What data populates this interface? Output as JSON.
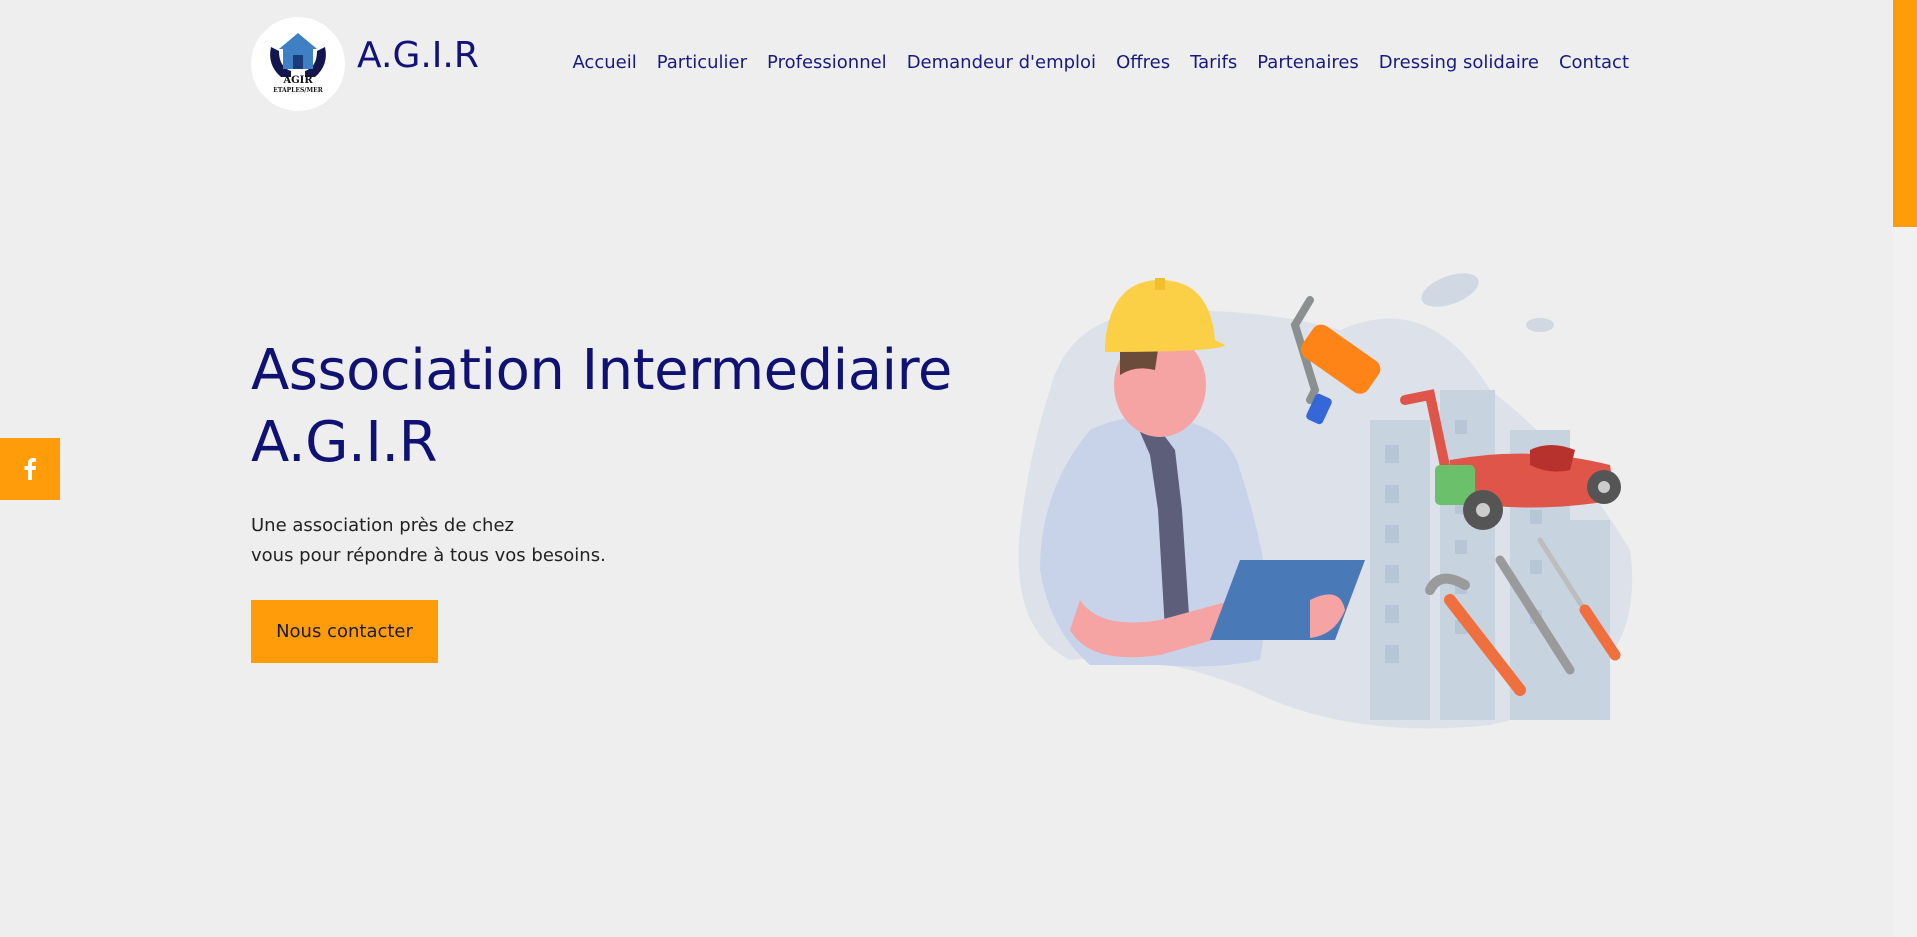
{
  "header": {
    "logo": {
      "text_line1": "AGIR",
      "text_line2": "ETAPLES/MER",
      "icon": "house-hands-icon"
    },
    "brand": "A.G.I.R",
    "nav": [
      {
        "label": "Accueil"
      },
      {
        "label": "Particulier"
      },
      {
        "label": "Professionnel"
      },
      {
        "label": "Demandeur d'emploi"
      },
      {
        "label": "Offres"
      },
      {
        "label": "Tarifs"
      },
      {
        "label": "Partenaires"
      },
      {
        "label": "Dressing solidaire"
      },
      {
        "label": "Contact"
      }
    ]
  },
  "hero": {
    "title_line1": "Association Intermediaire",
    "title_line2": "A.G.I.R",
    "text_line1": "Une association près de chez",
    "text_line2": "vous pour répondre à tous vos besoins.",
    "cta_label": "Nous contacter"
  },
  "social": {
    "facebook_icon": "facebook-icon"
  },
  "colors": {
    "accent": "#ff9c0a",
    "navy": "#12127a",
    "background": "#eeeeee"
  }
}
